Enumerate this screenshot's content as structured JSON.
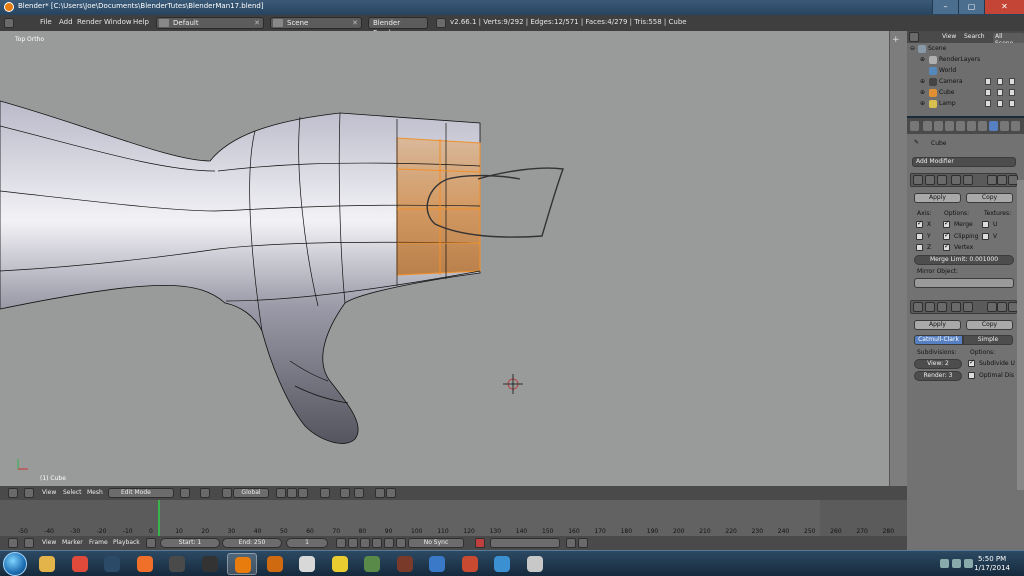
{
  "window": {
    "title": "Blender* [C:\\Users\\Joe\\Documents\\BlenderTutes\\BlenderMan17.blend]",
    "buttons": [
      "–",
      "▢",
      "✕"
    ]
  },
  "info_header": {
    "menus": [
      "File",
      "Add",
      "Render",
      "Window",
      "Help"
    ],
    "screen_layout": "Default",
    "scene": "Scene",
    "render_engine": "Blender Render",
    "stats": "v2.66.1 | Verts:9/292 | Edges:12/571 | Faces:4/279 | Tris:558 | Cube"
  },
  "viewport": {
    "view_label": "Top Ortho",
    "object_label": "(1) Cube",
    "header": {
      "menus": [
        "View",
        "Select",
        "Mesh"
      ],
      "mode": "Edit Mode",
      "orientation": "Global"
    }
  },
  "timeline": {
    "ticks": [
      "-50",
      "-40",
      "-30",
      "-20",
      "-10",
      "0",
      "10",
      "20",
      "30",
      "40",
      "50",
      "60",
      "70",
      "80",
      "90",
      "100",
      "110",
      "120",
      "130",
      "140",
      "150",
      "160",
      "170",
      "180",
      "190",
      "200",
      "210",
      "220",
      "230",
      "240",
      "250",
      "260",
      "270",
      "280"
    ],
    "header": {
      "menus": [
        "View",
        "Marker",
        "Frame",
        "Playback"
      ],
      "start": "Start: 1",
      "end": "End: 250",
      "current": "1",
      "sync": "No Sync"
    }
  },
  "outliner": {
    "header": {
      "view": "View",
      "search": "Search",
      "filter": "All Scene"
    },
    "items": [
      {
        "label": "Scene",
        "color": "#8899aa"
      },
      {
        "label": "RenderLayers",
        "color": "#b0b0b0"
      },
      {
        "label": "World",
        "color": "#5588bb"
      },
      {
        "label": "Camera",
        "color": "#444444"
      },
      {
        "label": "Cube",
        "color": "#e09030"
      },
      {
        "label": "Lamp",
        "color": "#d8c050"
      }
    ]
  },
  "properties": {
    "object_name": "Cube",
    "add_modifier": "Add Modifier",
    "mirror": {
      "apply": "Apply",
      "copy": "Copy",
      "axis_label": "Axis:",
      "options_label": "Options:",
      "textures_label": "Textures:",
      "axes": [
        "X",
        "Y",
        "Z"
      ],
      "axes_checked": [
        true,
        false,
        false
      ],
      "options": [
        "Merge",
        "Clipping",
        "Vertex"
      ],
      "options_checked": [
        true,
        true,
        true
      ],
      "textures": [
        "U",
        "V"
      ],
      "merge_limit": "Merge Limit: 0.001000",
      "mirror_object_label": "Mirror Object:"
    },
    "subsurf": {
      "apply": "Apply",
      "copy": "Copy",
      "catmull": "Catmull-Clark",
      "simple": "Simple",
      "subdivisions_label": "Subdivisions:",
      "options_label": "Options:",
      "view": "View: 2",
      "render": "Render: 3",
      "subdivide_uv": "Subdivide U",
      "optimal_display": "Optimal Dis"
    }
  },
  "taskbar": {
    "time": "5:50 PM",
    "date": "1/17/2014",
    "apps": [
      {
        "name": "folder",
        "color": "#e3b449"
      },
      {
        "name": "chrome",
        "color": "#e04a3a"
      },
      {
        "name": "steam",
        "color": "#2a4a68"
      },
      {
        "name": "origin",
        "color": "#f0702a"
      },
      {
        "name": "unity",
        "color": "#4a4a4a"
      },
      {
        "name": "unity2",
        "color": "#333333"
      },
      {
        "name": "blender",
        "color": "#e87d0d"
      },
      {
        "name": "blender2",
        "color": "#d06a10"
      },
      {
        "name": "notepad",
        "color": "#d8d8d8"
      },
      {
        "name": "banana",
        "color": "#e8cc30"
      },
      {
        "name": "palette",
        "color": "#5a8a4a"
      },
      {
        "name": "game",
        "color": "#7a3a2a"
      },
      {
        "name": "malwarebytes",
        "color": "#3a78c8"
      },
      {
        "name": "media",
        "color": "#c84a30"
      },
      {
        "name": "update",
        "color": "#3a90d0"
      },
      {
        "name": "lock",
        "color": "#c8c8c8"
      }
    ]
  }
}
